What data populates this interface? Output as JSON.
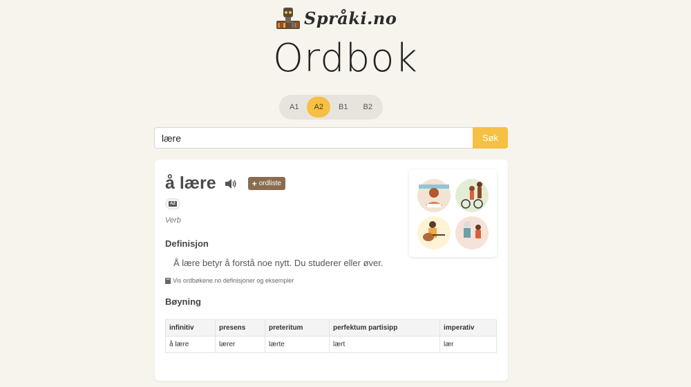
{
  "header": {
    "site_name": "Språki.no",
    "logo_icon": "bookshelf-robot-icon"
  },
  "page_title": "Ordbok",
  "levels": {
    "items": [
      "A1",
      "A2",
      "B1",
      "B2"
    ],
    "active": "A2"
  },
  "search": {
    "value": "lære",
    "button_label": "Søk"
  },
  "entry": {
    "word": "å lære",
    "wordlist_button": "ordliste",
    "level_badge": "A2",
    "word_class": "Verb",
    "definition_heading": "Definisjon",
    "definition": "Å lære betyr å forstå noe nytt. Du studerer eller øver.",
    "ordbok_link": "Vis ordbøkene.no definisjoner og eksempler",
    "conjugation_heading": "Bøyning",
    "conjugation": {
      "headers": [
        "infinitiv",
        "presens",
        "preteritum",
        "perfektum partisipp",
        "imperativ"
      ],
      "values": [
        "å lære",
        "lærer",
        "lærte",
        "lært",
        "lær"
      ]
    }
  },
  "colors": {
    "accent": "#f5c043",
    "wordlist_button": "#8a6d4e",
    "background": "#f7f4ee"
  }
}
